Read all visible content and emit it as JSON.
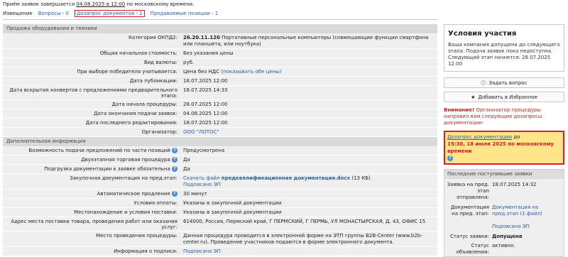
{
  "notice": {
    "prefix": "Приём заявок завершается ",
    "date": "04.08.2025 в 12:00",
    "suffix": " по московскому времени."
  },
  "tabs": [
    {
      "label": "Извещение"
    },
    {
      "label": "Вопросы - 0"
    },
    {
      "label": "Дозапрос документов - 1"
    },
    {
      "label": "Продаваемые позиции - 1"
    }
  ],
  "section1": {
    "title": "Продажа оборудования и техники"
  },
  "rows1": [
    {
      "label": "Категория ОКПД2:",
      "code": "26.20.11.120",
      "value": "Портативные персональные компьютеры (совмещающие функции смартфона или планшета, или ноутбука)"
    },
    {
      "label": "Общая начальная стоимость:",
      "value": "Без указания цены"
    },
    {
      "label": "Вид валюты:",
      "value": "руб."
    },
    {
      "label": "При выборе победителя учитывается:",
      "value": "Цена без НДС",
      "link": "(показывать обе цены)"
    },
    {
      "label": "Дата публикации:",
      "value": "18.07.2025 12:00"
    },
    {
      "label": "Дата вскрытия конвертов с предложениями предварительного этапа:",
      "value": "18.07.2025 14:33"
    },
    {
      "label": "Дата начала процедуры:",
      "value": "28.07.2025 12:00"
    },
    {
      "label": "Дата окончания подачи заявок:",
      "value": "04.08.2025 12:00"
    },
    {
      "label": "Дата последнего редактирования:",
      "value": "18.07.2025 12:00"
    },
    {
      "label": "Организатор:",
      "link": "ООО \"ЛОТОС\""
    }
  ],
  "section2": {
    "title": "Дополнительная информация"
  },
  "rows2": [
    {
      "label": "Возможность подачи предложений по части позиций",
      "value": "Предусмотрена"
    },
    {
      "label": "Двухэтапная торговая процедура",
      "value": "Да"
    },
    {
      "label": "Подгрузка документации к заявке обязательна",
      "value": "Да"
    },
    {
      "label": "Закупочная документация на пред.этап:",
      "link": "Скачать файл",
      "file": "предквалификационная документация.docx",
      "size": "(13 КБ)",
      "sig": "Подписано ЭП"
    },
    {
      "label": "Автоматическое продление",
      "value": "30 минут"
    },
    {
      "label": "Условия оплаты:",
      "value": "Указаны в закупочной документации"
    },
    {
      "label": "Местонахождение и условия поставки:",
      "value": "Указаны в закупочной документации"
    },
    {
      "label": "Адрес места поставки товара, проведения работ или оказания услуг:",
      "value": "614000, Россия, Пермский край, Г ПЕРМСКИЙ, Г ПЕРМЬ, УЛ МОНАСТЫРСКАЯ, Д. 43, ОФИС 15"
    },
    {
      "label": "Место проведения процедуры:",
      "value": "Данная процедура проводится в электронной форме на ЭТП группы B2B-Center (www.b2b-center.ru). Проведение участников подаются в форме электронного документа."
    },
    {
      "label": "Информация о подписи:",
      "link": "Подписано ЭП"
    }
  ],
  "side": {
    "title": "Условия участия",
    "text": "Ваша компания допущена до следующего этапа. Подача заявок пока недоступна. Следующий этап начнется: 28.07.2025 12:00",
    "ask_button": "Задать вопрос",
    "fav_button": "Добавить в Избранное",
    "warn_bold": "Внимание!",
    "warn_text": " Организатор процедуры направил вам следующие дозапросы документации:",
    "alert_link": "Дозапрос документации",
    "alert_to": " до",
    "alert_deadline": "15:30, 18 июля 2025 по московскому времени",
    "last_title": "Последние поступившие заявки",
    "last_rows": [
      {
        "label": "Заявка на пред. этап отправлена:",
        "value": "18.07.2025 14:32"
      },
      {
        "label": "Документация на пред. этап:",
        "link": "Документация на пред.этап (1 файл)",
        "sig": "Подписано ЭП"
      },
      {
        "label": "Статус заявки:",
        "value": "Допущена"
      },
      {
        "label": "Статус объявления:",
        "value": "активно."
      }
    ]
  },
  "colors": {
    "accent_red": "#d8182a",
    "link": "#2a5db0",
    "alert_bg": "#ffe48a"
  }
}
